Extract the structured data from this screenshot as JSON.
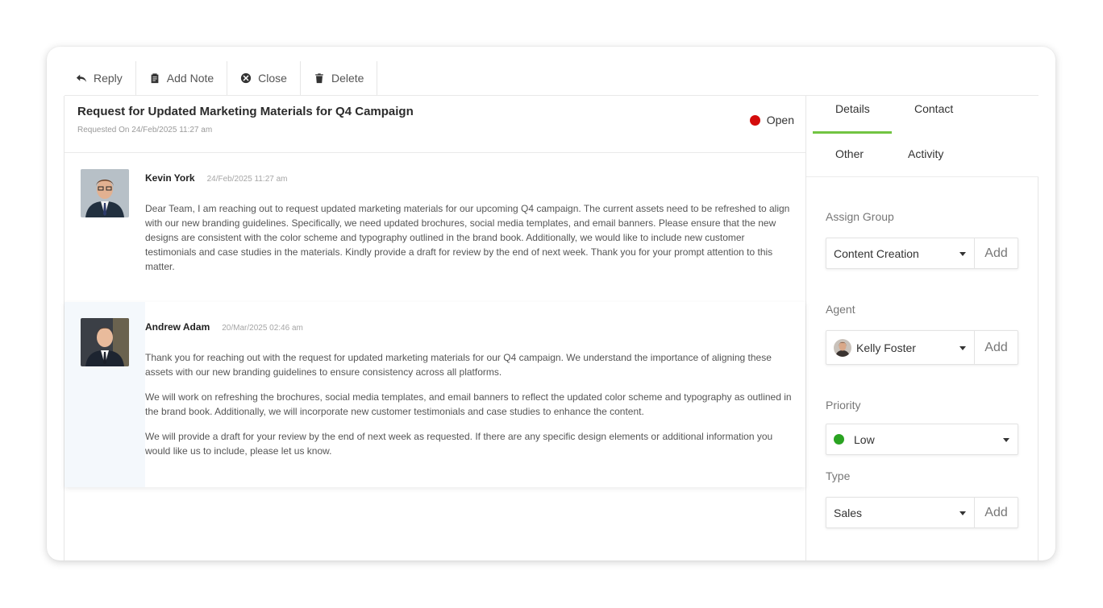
{
  "toolbar": {
    "reply": "Reply",
    "add_note": "Add Note",
    "close": "Close",
    "delete": "Delete"
  },
  "ticket": {
    "title": "Request for Updated Marketing Materials for Q4 Campaign",
    "requested_on": "Requested On 24/Feb/2025 11:27 am",
    "status": "Open",
    "status_color": "#d40b0b"
  },
  "messages": [
    {
      "author": "Kevin York",
      "date": "24/Feb/2025 11:27 am",
      "paragraphs": [
        "Dear Team, I am reaching out to request updated marketing materials for our upcoming Q4 campaign. The current assets need to be refreshed to align with our new branding guidelines. Specifically, we need updated brochures, social media templates, and email banners. Please ensure that the new designs are consistent with the color scheme and typography outlined in the brand book. Additionally, we would like to include new customer testimonials and case studies in the materials. Kindly provide a draft for review by the end of next week. Thank you for your prompt attention to this matter."
      ]
    },
    {
      "author": "Andrew Adam",
      "date": "20/Mar/2025 02:46 am",
      "paragraphs": [
        "Thank you for reaching out with the request for updated marketing materials for our Q4 campaign. We understand the importance of aligning these assets with our new branding guidelines to ensure consistency across all platforms.",
        "We will work on refreshing the brochures, social media templates, and email banners to reflect the updated color scheme and typography as outlined in the brand book. Additionally, we will incorporate new customer testimonials and case studies to enhance the content.",
        "We will provide a draft for your review by the end of next week as requested. If there are any specific design elements or additional information you would like us to include, please let us know."
      ]
    }
  ],
  "side": {
    "tabs": [
      "Details",
      "Contact",
      "Other",
      "Activity"
    ],
    "active_tab": "Details",
    "accent_color": "#72c442",
    "assign_group": {
      "label": "Assign Group",
      "value": "Content Creation",
      "add": "Add"
    },
    "agent": {
      "label": "Agent",
      "value": "Kelly Foster",
      "add": "Add"
    },
    "priority": {
      "label": "Priority",
      "value": "Low",
      "color": "#2aa321"
    },
    "type": {
      "label": "Type",
      "value": "Sales",
      "add": "Add"
    }
  }
}
